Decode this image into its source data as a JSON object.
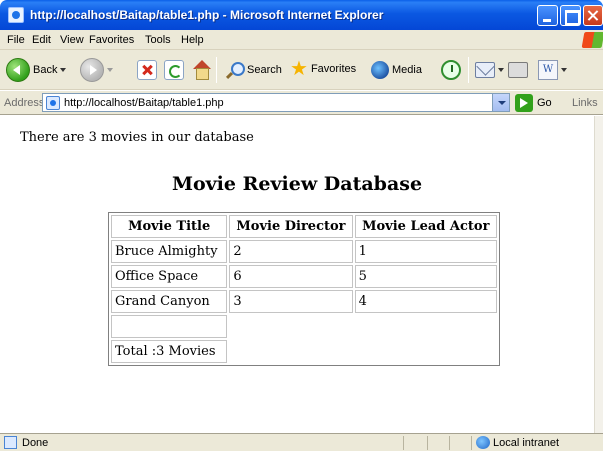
{
  "window": {
    "title": "http://localhost/Baitap/table1.php - Microsoft Internet Explorer"
  },
  "menu": {
    "file": "File",
    "edit": "Edit",
    "view": "View",
    "favorites": "Favorites",
    "tools": "Tools",
    "help": "Help"
  },
  "toolbar": {
    "back": "Back",
    "search": "Search",
    "favorites": "Favorites",
    "media": "Media"
  },
  "address": {
    "label": "Address",
    "url": "http://localhost/Baitap/table1.php",
    "go": "Go",
    "links": "Links"
  },
  "page": {
    "count_text": "There are 3 movies in our database",
    "title": "Movie Review Database",
    "table": {
      "headers": [
        "Movie Title",
        "Movie Director",
        "Movie Lead Actor"
      ],
      "rows": [
        [
          "Bruce Almighty",
          "2",
          "1"
        ],
        [
          "Office Space",
          "6",
          "5"
        ],
        [
          "Grand Canyon",
          "3",
          "4"
        ]
      ],
      "total": "Total :3 Movies"
    }
  },
  "status": {
    "text": "Done",
    "zone": "Local intranet"
  }
}
